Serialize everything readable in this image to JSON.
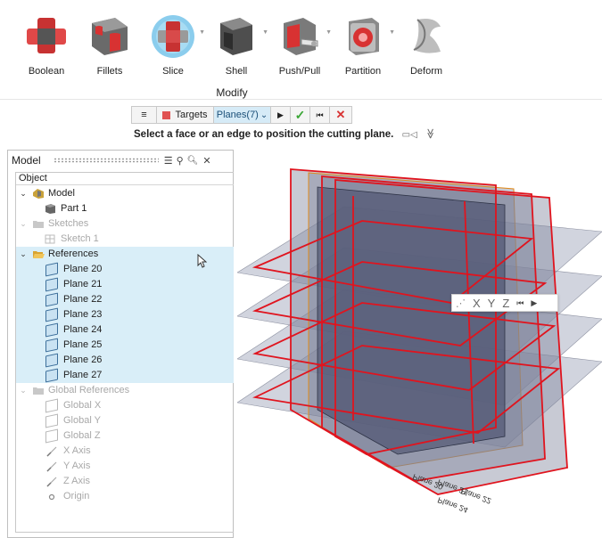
{
  "ribbon": {
    "title": "Modify",
    "tools": [
      {
        "label": "Boolean",
        "icon": "boolean-icon"
      },
      {
        "label": "Fillets",
        "icon": "fillets-icon"
      },
      {
        "label": "Slice",
        "icon": "slice-icon"
      },
      {
        "label": "Shell",
        "icon": "shell-icon"
      },
      {
        "label": "Push/Pull",
        "icon": "push-pull-icon"
      },
      {
        "label": "Partition",
        "icon": "partition-icon"
      },
      {
        "label": "Deform",
        "icon": "deform-icon"
      }
    ]
  },
  "toolbar": {
    "menu": "≡",
    "targets": "Targets",
    "planes": "Planes(7)",
    "planes_caret": "⌄",
    "play": "▶",
    "check": "✓",
    "reset": "⏮",
    "close": "✕",
    "accent": "#e05353",
    "check_color": "#3aa635"
  },
  "hint": {
    "text": "Select a face or an edge to position the cutting plane.",
    "camera": "▭◁",
    "collapse": "≫"
  },
  "panel": {
    "title": "Model",
    "icons": [
      "list-icon",
      "binoculars-icon",
      "search-icon",
      "close-icon"
    ],
    "icon_glyphs": [
      "☰",
      "⚲",
      "🔍︎",
      "✕"
    ],
    "header": "Object",
    "rows": [
      {
        "label": "Model",
        "chevron": "⌄"
      },
      {
        "label": "Part 1"
      },
      {
        "label": "Sketches",
        "chevron": "⌄"
      },
      {
        "label": "Sketch 1"
      },
      {
        "label": "References",
        "chevron": "⌄"
      },
      {
        "label": "Plane 20"
      },
      {
        "label": "Plane 21"
      },
      {
        "label": "Plane 22"
      },
      {
        "label": "Plane 23"
      },
      {
        "label": "Plane 24"
      },
      {
        "label": "Plane 25"
      },
      {
        "label": "Plane 26"
      },
      {
        "label": "Plane 27"
      },
      {
        "label": "Global References",
        "chevron": "⌄"
      },
      {
        "label": "Global X"
      },
      {
        "label": "Global Y"
      },
      {
        "label": "Global Z"
      },
      {
        "label": "X Axis"
      },
      {
        "label": "Y Axis"
      },
      {
        "label": "Z Axis"
      },
      {
        "label": "Origin"
      }
    ]
  },
  "viewport": {
    "plane_labels": [
      "Plane 20",
      "Plane 21",
      "Plane 22",
      "Plane 24"
    ],
    "floating_toolbar": {
      "axes": "⋰",
      "x": "X",
      "y": "Y",
      "z": "Z",
      "reset": "⏮",
      "play": "▶"
    },
    "colors": {
      "plane": "#8d93a8",
      "edge": "#e08a1a",
      "cut": "#e0141e",
      "solid": "#3f4564"
    }
  }
}
